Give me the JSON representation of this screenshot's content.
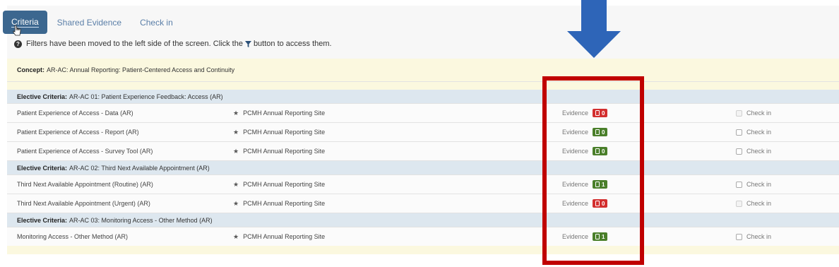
{
  "tabs": [
    {
      "label": "Criteria",
      "active": true
    },
    {
      "label": "Shared Evidence",
      "active": false
    },
    {
      "label": "Check in",
      "active": false
    }
  ],
  "info": {
    "text_before": "Filters have been moved to the left side of the screen. Click the",
    "text_after": "button to access them.",
    "icon": "question-circle-icon",
    "filter_icon": "filter-icon"
  },
  "concept": {
    "label": "Concept:",
    "value": "AR-AC: Annual Reporting: Patient-Centered Access and Continuity"
  },
  "sections": [
    {
      "label": "Elective Criteria:",
      "value": "AR-AC 01: Patient Experience Feedback: Access (AR)",
      "rows": [
        {
          "name": "Patient Experience of Access - Data (AR)",
          "site": "PCMH Annual Reporting Site",
          "evidence_label": "Evidence",
          "count": "0",
          "status": "red",
          "check_label": "Check in",
          "check_disabled": true
        },
        {
          "name": "Patient Experience of Access - Report (AR)",
          "site": "PCMH Annual Reporting Site",
          "evidence_label": "Evidence",
          "count": "0",
          "status": "green",
          "check_label": "Check in",
          "check_disabled": false
        },
        {
          "name": "Patient Experience of Access - Survey Tool (AR)",
          "site": "PCMH Annual Reporting Site",
          "evidence_label": "Evidence",
          "count": "0",
          "status": "green",
          "check_label": "Check in",
          "check_disabled": false
        }
      ]
    },
    {
      "label": "Elective Criteria:",
      "value": "AR-AC 02: Third Next Available Appointment (AR)",
      "rows": [
        {
          "name": "Third Next Available Appointment (Routine) (AR)",
          "site": "PCMH Annual Reporting Site",
          "evidence_label": "Evidence",
          "count": "1",
          "status": "green",
          "check_label": "Check in",
          "check_disabled": false
        },
        {
          "name": "Third Next Available Appointment (Urgent) (AR)",
          "site": "PCMH Annual Reporting Site",
          "evidence_label": "Evidence",
          "count": "0",
          "status": "red",
          "check_label": "Check in",
          "check_disabled": true
        }
      ]
    },
    {
      "label": "Elective Criteria:",
      "value": "AR-AC 03: Monitoring Access - Other Method (AR)",
      "rows": [
        {
          "name": "Monitoring Access - Other Method (AR)",
          "site": "PCMH Annual Reporting Site",
          "evidence_label": "Evidence",
          "count": "1",
          "status": "green",
          "check_label": "Check in",
          "check_disabled": false
        }
      ]
    }
  ],
  "colors": {
    "tab_active": "#3c678f",
    "badge_red": "#d32f2f",
    "badge_green": "#4a7f2a",
    "highlight": "#c00000",
    "arrow": "#2e65b8"
  }
}
